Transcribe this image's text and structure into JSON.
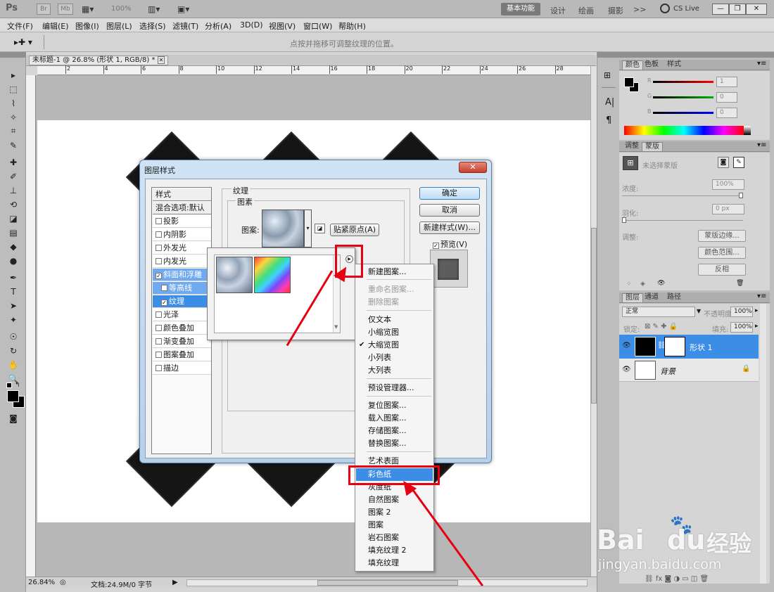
{
  "appbar": {
    "logo": "Ps",
    "btn_br": "Br",
    "btn_mb": "Mb",
    "zoom": "100%",
    "workspaces": {
      "active": "基本功能",
      "design": "设计",
      "paint": "绘画",
      "photo": "摄影",
      "more": ">>"
    },
    "cslive": "CS Live"
  },
  "menu": [
    "文件(F)",
    "编辑(E)",
    "图像(I)",
    "图层(L)",
    "选择(S)",
    "滤镜(T)",
    "分析(A)",
    "3D(D)",
    "视图(V)",
    "窗口(W)",
    "帮助(H)"
  ],
  "options": {
    "hint": "点按并拖移可调整纹理的位置。"
  },
  "document": {
    "tab_title": "未标题-1 @ 26.8% (形状 1, RGB/8) *",
    "ruler_marks": [
      "2",
      "4",
      "6",
      "8",
      "10",
      "12",
      "14",
      "16",
      "18",
      "20",
      "22",
      "24",
      "26",
      "28"
    ],
    "status_zoom": "26.84%",
    "status_doc": "文档:24.9M/0 字节"
  },
  "panels": {
    "color": {
      "tabs": [
        "颜色",
        "色板",
        "样式"
      ],
      "r_label": "R",
      "g_label": "G",
      "b_label": "B",
      "r": "1",
      "g": "0",
      "b": "0"
    },
    "masks": {
      "tabs": [
        "调整",
        "蒙版"
      ],
      "no_mask": "未选择蒙版",
      "density_label": "浓度:",
      "density": "100%",
      "feather_label": "羽化:",
      "feather": "0 px",
      "refine_label": "调整:",
      "btn_edge": "蒙版边缘...",
      "btn_range": "颜色范围...",
      "btn_invert": "反相"
    },
    "layers": {
      "tabs": [
        "图层",
        "通道",
        "路径"
      ],
      "blend": "正常",
      "opacity_label": "不透明度:",
      "opacity": "100%",
      "lock_label": "锁定:",
      "fill_label": "填充:",
      "fill": "100%",
      "layer1": "形状 1",
      "layer_bg": "背景"
    }
  },
  "dialog": {
    "title": "图层样式",
    "styles": {
      "header": "样式",
      "blend_opts": "混合选项:默认",
      "items": [
        "投影",
        "内阴影",
        "外发光",
        "内发光",
        "斜面和浮雕",
        "等高线",
        "纹理",
        "光泽",
        "颜色叠加",
        "渐变叠加",
        "图案叠加",
        "描边"
      ]
    },
    "section_title": "纹理",
    "group_title": "图素",
    "pattern_label": "图案:",
    "snap_btn": "贴紧原点(A)",
    "ok": "确定",
    "cancel": "取消",
    "new_style": "新建样式(W)...",
    "preview": "预览(V)"
  },
  "context_menu": {
    "items": [
      "新建图案...",
      "重命名图案...",
      "删除图案",
      "仅文本",
      "小缩览图",
      "大缩览图",
      "小列表",
      "大列表",
      "预设管理器...",
      "复位图案...",
      "载入图案...",
      "存储图案...",
      "替换图案...",
      "艺术表面",
      "彩色纸",
      "灰度纸",
      "自然图案",
      "图案 2",
      "图案",
      "岩石图案",
      "填充纹理 2",
      "填充纹理"
    ],
    "check_mark": "✔"
  },
  "watermark": {
    "brand": "Bai",
    "brand2": "du",
    "brand3": "经验",
    "url": "jingyan.baidu.com"
  }
}
